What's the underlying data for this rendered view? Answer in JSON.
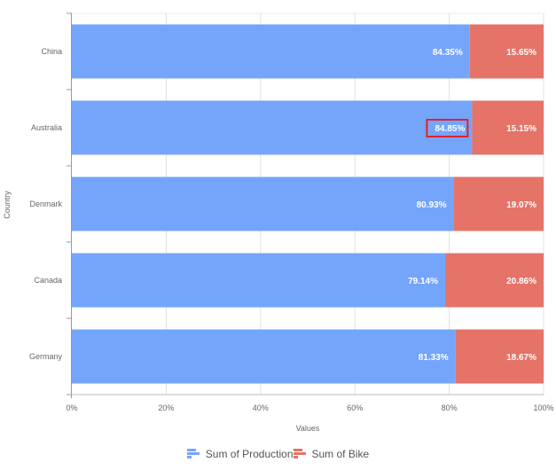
{
  "chart_data": {
    "type": "bar",
    "orientation": "horizontal",
    "stacked": "percent",
    "categories": [
      "China",
      "Australia",
      "Denmark",
      "Canada",
      "Germany"
    ],
    "series": [
      {
        "name": "Sum of Production",
        "color": "#75a5fb",
        "values": [
          84.35,
          84.85,
          80.93,
          79.14,
          81.33
        ],
        "labels": [
          "84.35%",
          "84.85%",
          "80.93%",
          "79.14%",
          "81.33%"
        ]
      },
      {
        "name": "Sum of Bike",
        "color": "#e57368",
        "values": [
          15.65,
          15.15,
          19.07,
          20.86,
          18.67
        ],
        "labels": [
          "15.65%",
          "15.15%",
          "19.07%",
          "20.86%",
          "18.67%"
        ]
      }
    ],
    "xlabel": "Values",
    "ylabel": "Country",
    "xlim": [
      0,
      100
    ],
    "xticks": [
      "0%",
      "20%",
      "40%",
      "60%",
      "80%",
      "100%"
    ],
    "grid": true,
    "legend_position": "bottom",
    "highlighted_label": {
      "series": 0,
      "category": "Australia",
      "color": "#e3202a"
    }
  }
}
